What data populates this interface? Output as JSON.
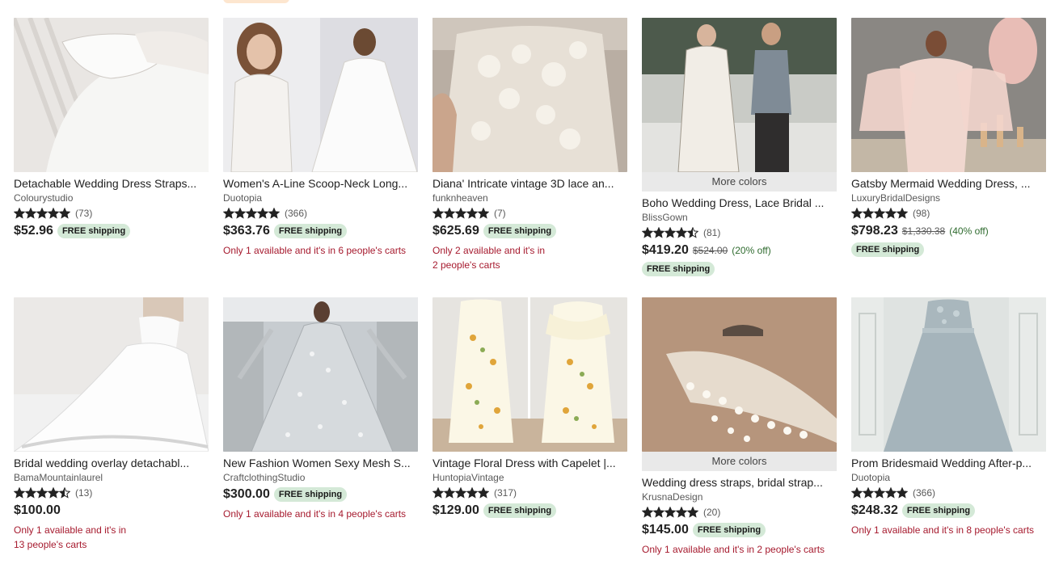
{
  "colors": {
    "badge_bg": "#d4e9d7",
    "scarcity": "#a61a2e",
    "star": "#222222"
  },
  "cards": [
    {
      "title": "Detachable Wedding Dress Straps...",
      "shop": "Colourystudio",
      "rating": 5,
      "reviews": "(73)",
      "price": "$52.96",
      "free_shipping": "FREE shipping",
      "image": "lace-sleeve-white-bodice"
    },
    {
      "title": "Women's A-Line Scoop-Neck Long...",
      "shop": "Duotopia",
      "rating": 5,
      "reviews": "(366)",
      "price": "$363.76",
      "free_shipping": "FREE shipping",
      "scarcity": "Only 1 available and it's in 6 people's carts",
      "image": "model-lace-long-sleeve-gown"
    },
    {
      "title": "Diana' Intricate vintage 3D lace an...",
      "shop": "funknheaven",
      "rating": 5,
      "reviews": "(7)",
      "price": "$625.69",
      "free_shipping": "FREE shipping",
      "scarcity_line1": "Only 2 available and it's in",
      "scarcity_line2": "2 people's carts",
      "image": "3d-lace-bodice-closeup"
    },
    {
      "more_colors": "More colors",
      "title": "Boho Wedding Dress, Lace Bridal ...",
      "shop": "BlissGown",
      "rating": 4.5,
      "reviews": "(81)",
      "price": "$419.20",
      "original_price": "$524.00",
      "discount": "(20% off)",
      "free_shipping": "FREE shipping",
      "image": "couple-boho-lace-dress"
    },
    {
      "title": "Gatsby Mermaid Wedding Dress, ...",
      "shop": "LuxuryBridalDesigns",
      "rating": 5,
      "reviews": "(98)",
      "price": "$798.23",
      "original_price": "$1,330.38",
      "discount": "(40% off)",
      "free_shipping": "FREE shipping",
      "image": "gatsby-feather-cape-dress"
    },
    {
      "title": "Bridal wedding overlay detachabl...",
      "shop": "BamaMountainlaurel",
      "rating": 4.5,
      "reviews": "(13)",
      "price": "$100.00",
      "scarcity_line1": "Only 1 available and it's in",
      "scarcity_line2": "13 people's carts",
      "image": "white-tulle-overlay-train"
    },
    {
      "title": "New Fashion Women Sexy Mesh S...",
      "shop": "CraftclothingStudio",
      "rating": null,
      "reviews": "",
      "price": "$300.00",
      "free_shipping": "FREE shipping",
      "scarcity": "Only 1 available and it's in 4 people's carts",
      "image": "silver-star-gown-cape"
    },
    {
      "title": "Vintage Floral Dress with Capelet |...",
      "shop": "HuntopiaVintage",
      "rating": 5,
      "reviews": "(317)",
      "price": "$129.00",
      "free_shipping": "FREE shipping",
      "image": "floral-dress-on-mannequin"
    },
    {
      "more_colors": "More colors",
      "title": "Wedding dress straps, bridal strap...",
      "shop": "KrusnaDesign",
      "rating": 5,
      "reviews": "(20)",
      "price": "$145.00",
      "free_shipping": "FREE shipping",
      "scarcity": "Only 1 available and it's in 2 people's carts",
      "image": "pearl-shoulder-strap"
    },
    {
      "title": "Prom Bridesmaid Wedding After-p...",
      "shop": "Duotopia",
      "rating": 5,
      "reviews": "(366)",
      "price": "$248.32",
      "free_shipping": "FREE shipping",
      "scarcity": "Only 1 available and it's in 8 people's carts",
      "image": "dusty-blue-tulle-gown"
    }
  ]
}
